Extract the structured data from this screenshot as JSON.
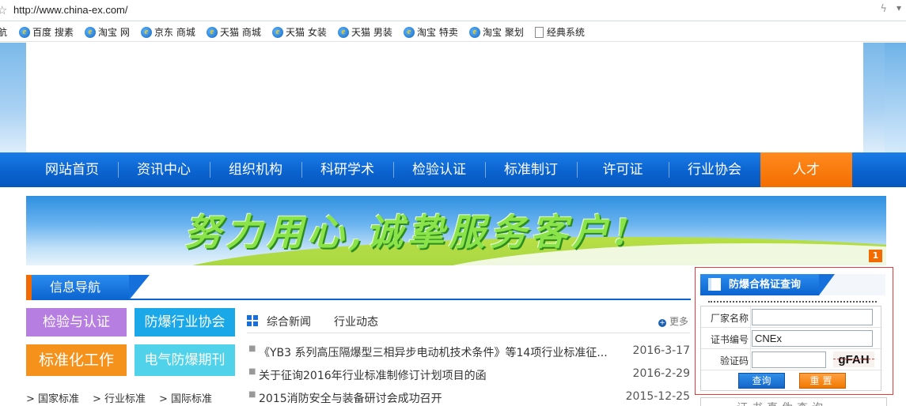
{
  "browser": {
    "url": "http://www.china-ex.com/",
    "favorites_partial": "航",
    "favorites": [
      {
        "label": "百度 搜素"
      },
      {
        "label": "淘宝 网"
      },
      {
        "label": "京东 商城"
      },
      {
        "label": "天猫 商城"
      },
      {
        "label": "天猫 女装"
      },
      {
        "label": "天猫 男装"
      },
      {
        "label": "淘宝 特卖"
      },
      {
        "label": "淘宝 聚划"
      },
      {
        "label": "经典系统"
      }
    ]
  },
  "nav": {
    "items": [
      "网站首页",
      "资讯中心",
      "组织机构",
      "科研学术",
      "检验认证",
      "标准制订",
      "许可证",
      "行业协会",
      "人才"
    ],
    "active_index": 8
  },
  "banner": {
    "slogan": "努力用心,诚挚服务客户!",
    "badge": "1"
  },
  "info_nav": {
    "title": "信息导航",
    "buttons": [
      "检验与认证",
      "防爆行业协会",
      "标准化工作",
      "电气防爆期刊"
    ],
    "sub_links": [
      "> 国家标准",
      "> 行业标准",
      "> 国际标准"
    ]
  },
  "news": {
    "tabs": [
      "综合新闻",
      "行业动态"
    ],
    "more": "更多",
    "items": [
      {
        "title": "《YB3 系列高压隔爆型三相异步电动机技术条件》等14项行业标准征...",
        "date": "2016-3-17"
      },
      {
        "title": "关于征询2016年行业标准制修订计划项目的函",
        "date": "2016-2-29"
      },
      {
        "title": "2015消防安全与装备研讨会成功召开",
        "date": "2015-12-25"
      }
    ]
  },
  "cert_query": {
    "title": "防爆合格证查询",
    "fields": [
      {
        "label": "厂家名称",
        "value": ""
      },
      {
        "label": "证书编号",
        "value": "CNEx"
      },
      {
        "label": "验证码",
        "value": ""
      }
    ],
    "captcha": "gFAH",
    "query_button": "查询",
    "reset_button": "重置",
    "below_text": "证书真伪查询"
  },
  "colors": {
    "nav_blue": "#0b63cf",
    "active_orange": "#f36e00",
    "cert_border": "#e23b3b"
  }
}
